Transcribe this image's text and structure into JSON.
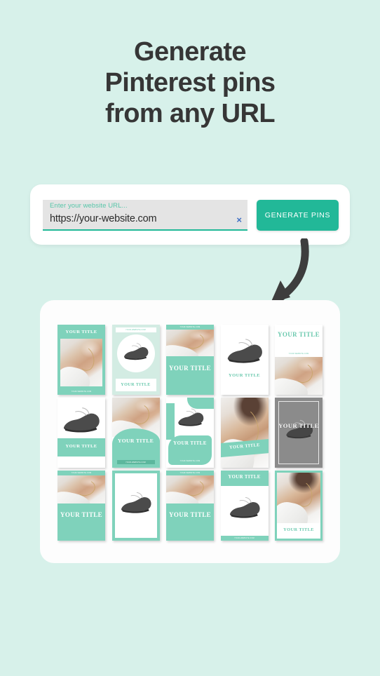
{
  "page": {
    "background_color": "#d7f1ea",
    "accent_color": "#22b898",
    "card_teal": "#7fd2bb",
    "title_color": "#363636"
  },
  "headline": {
    "line1": "Generate",
    "line2": "Pinterest pins",
    "line3": "from any URL"
  },
  "url_form": {
    "field_label": "Enter your website URL...",
    "field_value": "https://your-website.com",
    "field_placeholder": "Enter your website URL...",
    "clear_icon": "×",
    "generate_button": "GENERATE PINS"
  },
  "arrow": {
    "icon": "curved-arrow-down-left-icon",
    "color": "#3d3d3d"
  },
  "pin_grid": {
    "columns": 5,
    "rows": 3,
    "default_title": "YOUR TITLE",
    "default_url": "YOUR-WEBSITE.COM",
    "pins": [
      {
        "id": 1,
        "layout": "title-top-photo",
        "title": "YOUR TITLE",
        "url": "YOUR-WEBSITE.COM"
      },
      {
        "id": 2,
        "layout": "teal-circle-shoe",
        "title": "YOUR TITLE",
        "url": "YOUR-WEBSITE.COM"
      },
      {
        "id": 3,
        "layout": "topbar-photo-title",
        "title": "YOUR TITLE",
        "url": "YOUR-WEBSITE.COM"
      },
      {
        "id": 4,
        "layout": "white-shoe-title",
        "title": "YOUR TITLE",
        "url": ""
      },
      {
        "id": 5,
        "layout": "title-url-photo",
        "title": "YOUR TITLE",
        "url": "YOUR-WEBSITE.COM"
      },
      {
        "id": 6,
        "layout": "shoe-band-title",
        "title": "YOUR TITLE",
        "url": ""
      },
      {
        "id": 7,
        "layout": "photo-curve-title-footer",
        "title": "YOUR TITLE",
        "url": "YOUR-WEBSITE.COM"
      },
      {
        "id": 8,
        "layout": "blob-shoe-title",
        "title": "YOUR TITLE",
        "url": "YOUR-WEBSITE.COM"
      },
      {
        "id": 9,
        "layout": "photo-diagonal-title",
        "title": "YOUR TITLE",
        "url": ""
      },
      {
        "id": 10,
        "layout": "grey-frame-shoe-title",
        "title": "YOUR TITLE",
        "url": ""
      },
      {
        "id": 11,
        "layout": "topbar-photo-bigtitle",
        "title": "YOUR TITLE",
        "url": "YOUR-WEBSITE.COM"
      },
      {
        "id": 12,
        "layout": "teal-frame-shoe",
        "title": "",
        "url": ""
      },
      {
        "id": 13,
        "layout": "topbar-photo-bigtitle",
        "title": "YOUR TITLE",
        "url": "YOUR-WEBSITE.COM"
      },
      {
        "id": 14,
        "layout": "titlebar-shoe-footer",
        "title": "YOUR TITLE",
        "url": "YOUR-WEBSITE.COM"
      },
      {
        "id": 15,
        "layout": "teal-frame-photo-title",
        "title": "YOUR TITLE",
        "url": ""
      }
    ]
  }
}
